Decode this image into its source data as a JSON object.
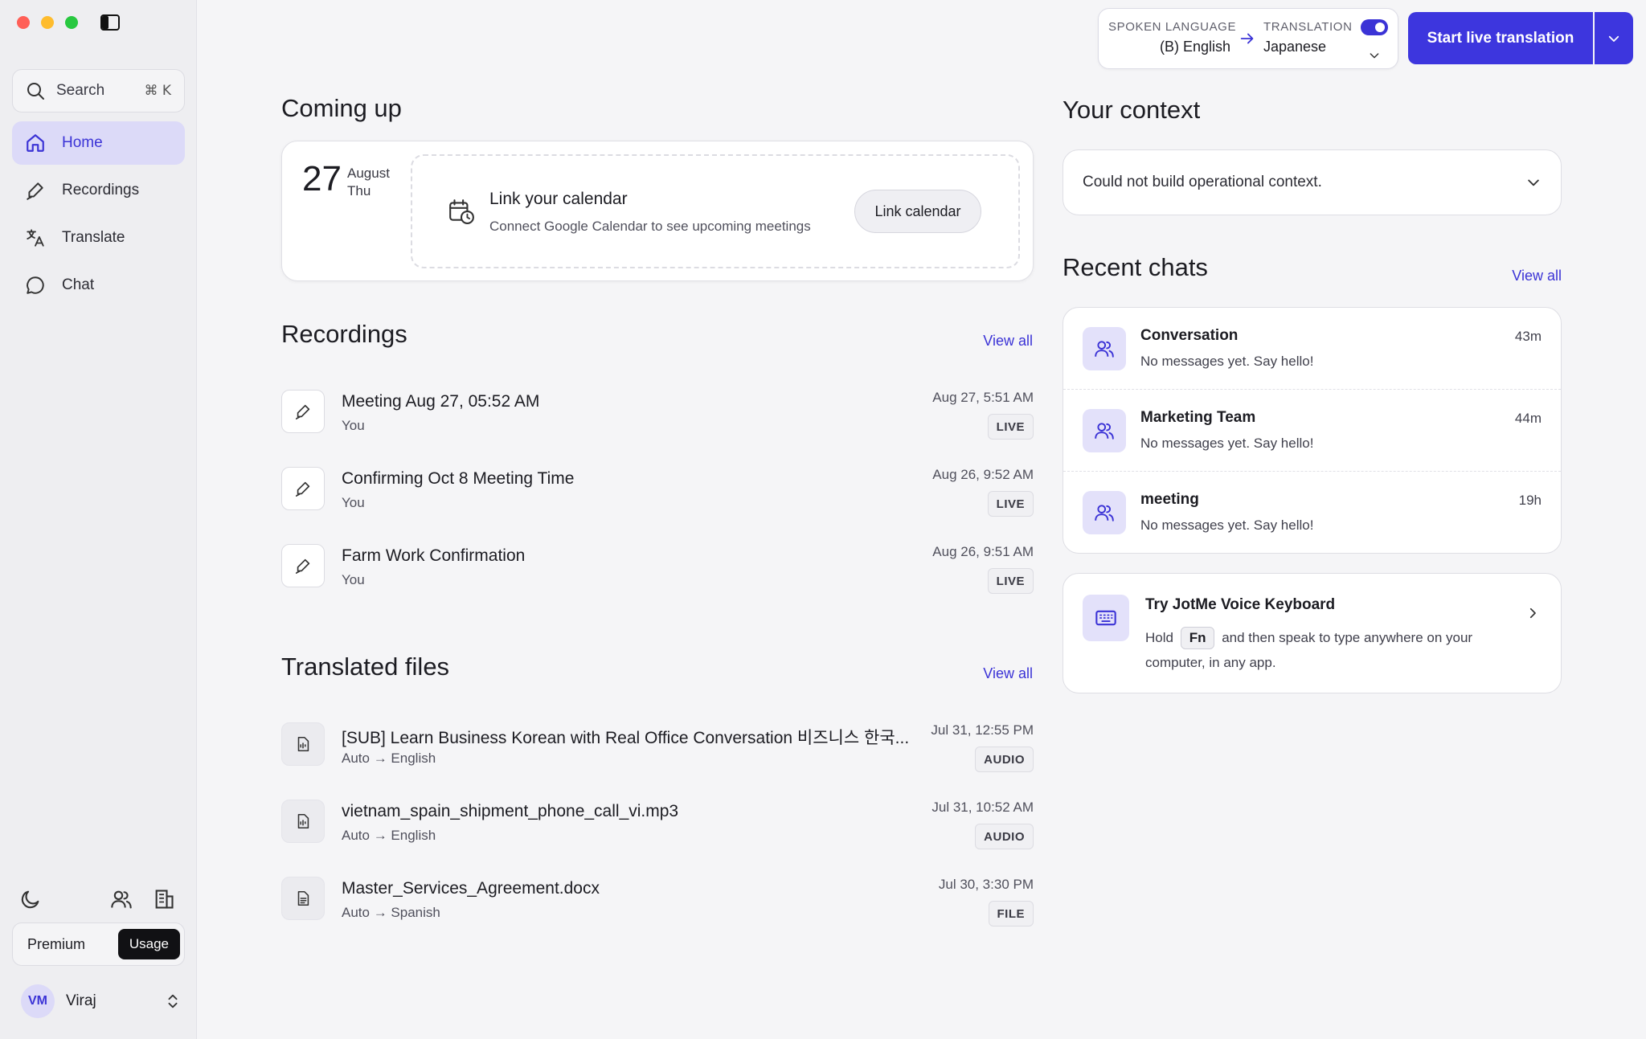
{
  "sidebar": {
    "search": {
      "label": "Search",
      "shortcut": "⌘ K"
    },
    "items": [
      {
        "label": "Home",
        "icon": "home-icon",
        "active": true
      },
      {
        "label": "Recordings",
        "icon": "pen-icon",
        "active": false
      },
      {
        "label": "Translate",
        "icon": "translate-icon",
        "active": false
      },
      {
        "label": "Chat",
        "icon": "chat-bubble-icon",
        "active": false
      }
    ],
    "plan": {
      "premium_label": "Premium",
      "usage_label": "Usage"
    },
    "user": {
      "initials": "VM",
      "name": "Viraj"
    }
  },
  "topbar": {
    "spoken_caption": "SPOKEN LANGUAGE",
    "spoken_value": "(B) English",
    "translation_caption": "TRANSLATION",
    "translation_value": "Japanese",
    "translation_enabled": true,
    "start_label": "Start live translation"
  },
  "coming_up": {
    "heading": "Coming up",
    "day": "27",
    "month": "August",
    "weekday": "Thu",
    "calendar_title": "Link your calendar",
    "calendar_sub": "Connect Google Calendar to see upcoming meetings",
    "link_button": "Link calendar"
  },
  "recordings": {
    "heading": "Recordings",
    "view_all": "View all",
    "items": [
      {
        "title": "Meeting Aug 27, 05:52 AM",
        "sub": "You",
        "time": "Aug 27, 5:51 AM",
        "badge": "LIVE"
      },
      {
        "title": "Confirming Oct 8 Meeting Time",
        "sub": "You",
        "time": "Aug 26, 9:52 AM",
        "badge": "LIVE"
      },
      {
        "title": "Farm Work Confirmation",
        "sub": "You",
        "time": "Aug 26, 9:51 AM",
        "badge": "LIVE"
      }
    ]
  },
  "translated_files": {
    "heading": "Translated files",
    "view_all": "View all",
    "items": [
      {
        "title": "[SUB] Learn Business Korean with Real Office Conversation 비즈니스 한국...",
        "sub": "Auto → English",
        "time": "Jul 31, 12:55 PM",
        "badge": "AUDIO"
      },
      {
        "title": "vietnam_spain_shipment_phone_call_vi.mp3",
        "sub": "Auto → English",
        "time": "Jul 31, 10:52 AM",
        "badge": "AUDIO"
      },
      {
        "title": "Master_Services_Agreement.docx",
        "sub": "Auto → Spanish",
        "time": "Jul 30, 3:30 PM",
        "badge": "FILE"
      }
    ]
  },
  "context": {
    "heading": "Your context",
    "message": "Could not build operational context."
  },
  "recent_chats": {
    "heading": "Recent chats",
    "view_all": "View all",
    "items": [
      {
        "name": "Conversation",
        "message": "No messages yet. Say hello!",
        "time": "43m"
      },
      {
        "name": "Marketing Team",
        "message": "No messages yet. Say hello!",
        "time": "44m"
      },
      {
        "name": "meeting",
        "message": "No messages yet. Say hello!",
        "time": "19h"
      }
    ]
  },
  "voice_keyboard": {
    "title": "Try JotMe Voice Keyboard",
    "text_before": "Hold",
    "key": "Fn",
    "text_after": "and then speak to type anywhere on your computer, in any app."
  },
  "colors": {
    "accent": "#3d36de",
    "active_nav_bg": "#dcdaf8",
    "background": "#f5f5f7"
  }
}
